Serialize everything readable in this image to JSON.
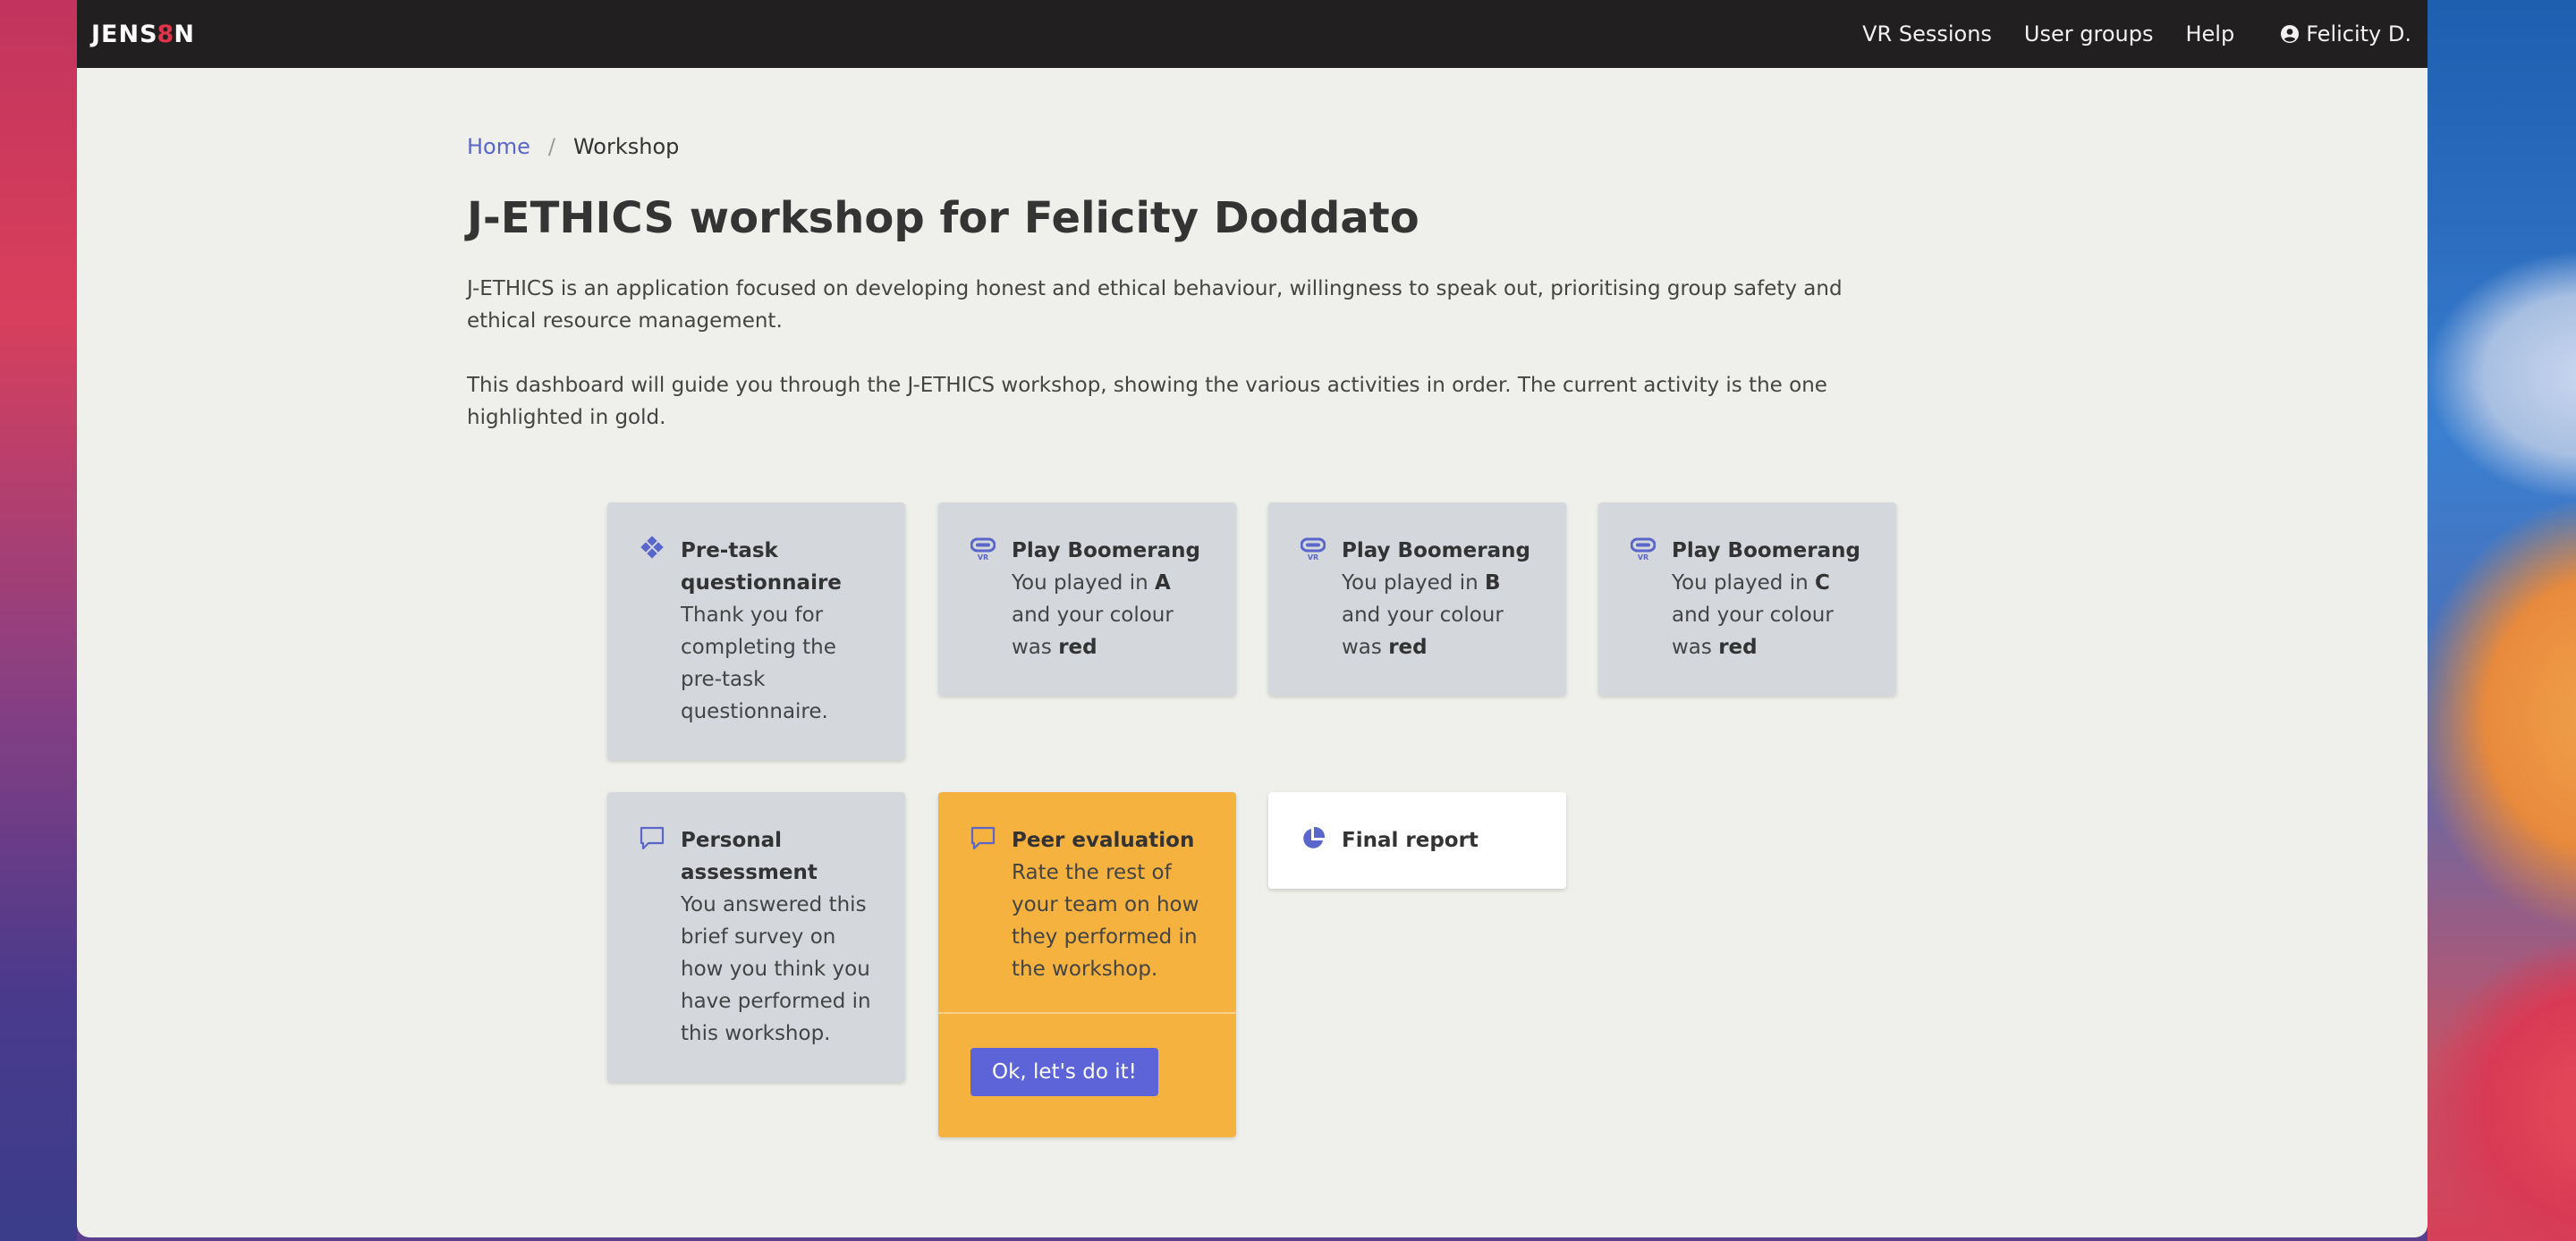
{
  "navbar": {
    "brand_left": "JENS",
    "brand_eight": "8",
    "brand_right": "N",
    "links": [
      {
        "label": "VR Sessions"
      },
      {
        "label": "User groups"
      },
      {
        "label": "Help"
      }
    ],
    "user": {
      "label": "Felicity D.",
      "icon": "user-circle-icon"
    }
  },
  "breadcrumb": {
    "home": "Home",
    "separator": "/",
    "current": "Workshop"
  },
  "page": {
    "title": "J-ETHICS workshop for Felicity Doddato",
    "intro1": "J-ETHICS is an application focused on developing honest and ethical behaviour, willingness to speak out, prioritising group safety and ethical resource management.",
    "intro2": "This dashboard will guide you through the J-ETHICS workshop, showing the various activities in order. The current activity is the one highlighted in gold."
  },
  "cards": {
    "pretask": {
      "title": "Pre-task questionnaire",
      "text": "Thank you for completing the pre-task questionnaire.",
      "icon": "diamond-grid-icon"
    },
    "play_a": {
      "title": "Play Boomerang",
      "text1": "You played in ",
      "room": "A",
      "text2": " and your colour was ",
      "colour": "red",
      "icon": "vr-headset-icon"
    },
    "play_b": {
      "title": "Play Boomerang",
      "text1": "You played in ",
      "room": "B",
      "text2": " and your colour was ",
      "colour": "red",
      "icon": "vr-headset-icon"
    },
    "play_c": {
      "title": "Play Boomerang",
      "text1": "You played in ",
      "room": "C",
      "text2": " and your colour was ",
      "colour": "red",
      "icon": "vr-headset-icon"
    },
    "personal": {
      "title": "Personal assessment",
      "text": "You answered this brief survey on how you think you have performed in this workshop.",
      "icon": "speech-bubble-icon"
    },
    "peer": {
      "title": "Peer evaluation",
      "text": "Rate the rest of your team on how they performed in the workshop.",
      "button": "Ok, let's do it!",
      "icon": "speech-bubble-icon"
    },
    "final": {
      "title": "Final report",
      "icon": "pie-chart-icon"
    }
  },
  "colors": {
    "accent": "#5c64d8",
    "gold": "#f6b23f",
    "card_grey": "#d4d8dd",
    "navbar": "#221f20"
  }
}
